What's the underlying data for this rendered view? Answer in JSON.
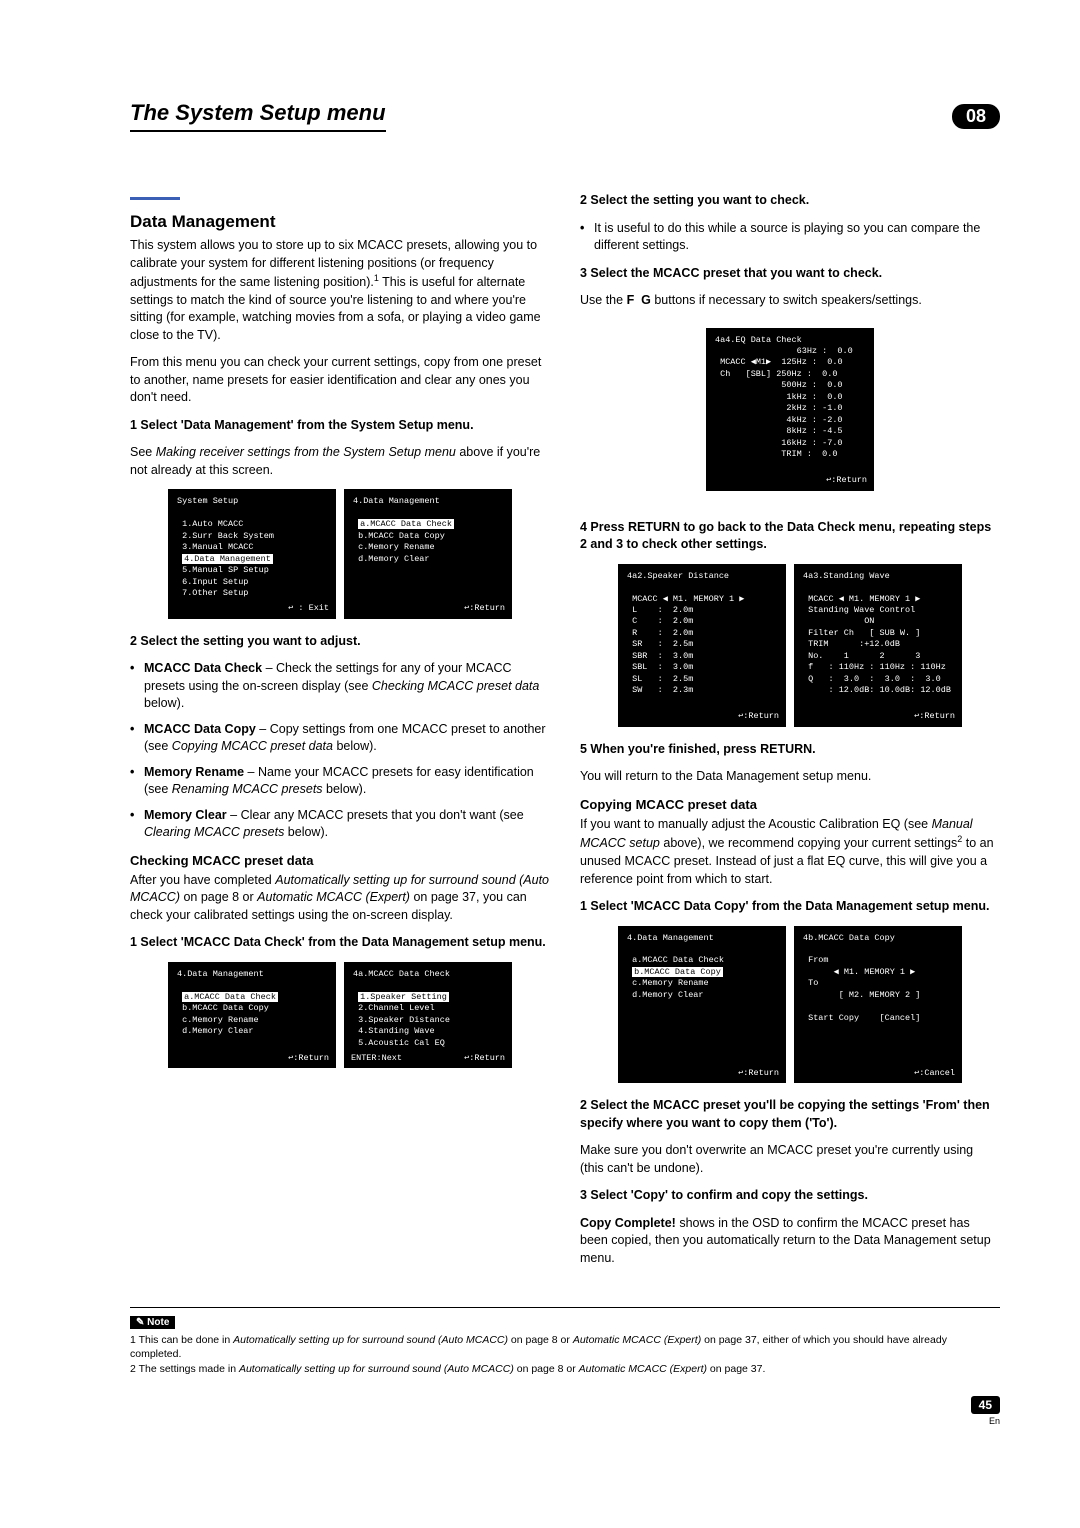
{
  "header": {
    "title": "The System Setup menu",
    "chapter": "08"
  },
  "left": {
    "accent": true,
    "h2": "Data Management",
    "p1a": "This system allows you to store up to six MCACC presets, allowing you to calibrate your system for different listening positions (or frequency adjustments for the same listening position).",
    "p1b": " This is useful for alternate settings to match the kind of source you're listening to and where you're sitting (for example, watching movies from a sofa, or playing a video game close to the TV).",
    "p2": "From this menu you can check your current settings, copy from one preset to another, name presets for easier identification and clear any ones you don't need.",
    "step1": "1   Select 'Data Management' from the System Setup menu.",
    "step1_after_a": "See ",
    "step1_after_i": "Making receiver settings from the System Setup menu",
    "step1_after_b": " above if you're not already at this screen.",
    "osd_sys": "System Setup\n\n  1.Auto MCACC\n  2.Surr Back System\n  3.Manual MCACC\n  4.Data Management\n  5.Manual SP Setup\n  6.Input Setup\n  7.Other Setup",
    "osd_sys_hl": "4.Data Management",
    "osd_sys_foot": "↩ : Exit",
    "osd_dm1": "4.Data Management\n\n  a.MCACC Data Check\n  b.MCACC Data Copy\n  c.Memory Rename\n  d.Memory Clear",
    "osd_dm1_hl": "a.MCACC Data Check",
    "osd_dm1_foot": "↩:Return",
    "step2": "2   Select the setting you want to adjust.",
    "b1a": "MCACC Data Check",
    "b1b": " – Check the settings for any of your MCACC presets using the on-screen display (see ",
    "b1i": "Checking MCACC preset data",
    "b1c": " below).",
    "b2a": "MCACC Data Copy",
    "b2b": " – Copy settings from one MCACC preset to another (see ",
    "b2i": "Copying MCACC preset data",
    "b2c": " below).",
    "b3a": "Memory Rename",
    "b3b": " – Name your MCACC presets for easy identification (see ",
    "b3i": "Renaming MCACC presets",
    "b3c": " below).",
    "b4a": "Memory Clear",
    "b4b": " – Clear any MCACC presets that you don't want (see ",
    "b4i": "Clearing MCACC presets",
    "b4c": " below).",
    "sub1": "Checking MCACC preset data",
    "sub1_p_a": "After you have completed ",
    "sub1_p_i1": "Automatically setting up for surround sound (Auto MCACC)",
    "sub1_p_b": " on page 8 or ",
    "sub1_p_i2": "Automatic MCACC (Expert)",
    "sub1_p_c": " on page 37, you can check your calibrated settings using the on-screen display.",
    "step1b": "1   Select 'MCACC Data Check' from the Data Management setup menu.",
    "osd_dm2": "4.Data Management\n\n  a.MCACC Data Check\n  b.MCACC Data Copy\n  c.Memory Rename\n  d.Memory Clear",
    "osd_dm2_hl": "a.MCACC Data Check",
    "osd_dm2_foot": "↩:Return",
    "osd_dc": "4a.MCACC Data Check\n\n  1.Speaker Setting\n  2.Channel Level\n  3.Speaker Distance\n  4.Standing Wave\n  5.Acoustic Cal EQ",
    "osd_dc_hl": "1.Speaker Setting",
    "osd_dc_footl": "ENTER:Next",
    "osd_dc_foot": "↩:Return"
  },
  "right": {
    "step2": "2   Select the setting you want to check.",
    "step2_note": "It is useful to do this while a source is playing so you can compare the different settings.",
    "step3": "3   Select the MCACC preset that you want to check.",
    "step3_p_a": "Use the  ",
    "step3_p_b": "  buttons if necessary to switch speakers/settings.",
    "osd_eq": "4a4.EQ Data Check\n                63Hz :  0.0\n MCACC ◀M1▶  125Hz :  0.0\n Ch   [SBL] 250Hz :  0.0\n             500Hz :  0.0\n              1kHz :  0.0\n              2kHz : -1.0\n              4kHz : -2.0\n              8kHz : -4.5\n             16kHz : -7.0\n             TRIM :  0.0",
    "osd_eq_foot": "↩:Return",
    "step4": "4   Press RETURN to go back to the Data Check menu, repeating steps 2 and 3 to check other settings.",
    "osd_sp": "4a2.Speaker Distance\n\n MCACC ◀ M1. MEMORY 1 ▶\n L    :  2.0m\n C    :  2.0m\n R    :  2.0m\n SR   :  2.5m\n SBR  :  3.0m\n SBL  :  3.0m\n SL   :  2.5m\n SW   :  2.3m",
    "osd_sp_foot": "↩:Return",
    "osd_sw": "4a3.Standing Wave\n\n MCACC ◀ M1. MEMORY 1 ▶\n Standing Wave Control\n            ON\n Filter Ch   [ SUB W. ]\n TRIM      :+12.0dB\n No.    1      2      3\n f   : 110Hz : 110Hz : 110Hz\n Q   :  3.0  :  3.0  :  3.0\n     : 12.0dB: 10.0dB: 12.0dB",
    "osd_sw_foot": "↩:Return",
    "step5": "5   When you're finished, press RETURN.",
    "step5_p": "You will return to the Data Management setup menu.",
    "sub2": "Copying MCACC preset data",
    "sub2_p_a": "If you want to manually adjust the Acoustic Calibration EQ (see ",
    "sub2_p_i": "Manual MCACC setup",
    "sub2_p_b": " above), we recommend copying your current settings",
    "sub2_p_c": " to an unused MCACC preset. Instead of just a flat EQ curve, this will give you a reference point from which to start.",
    "step1c": "1   Select 'MCACC Data Copy' from the Data Management setup menu.",
    "osd_dm3": "4.Data Management\n\n  a.MCACC Data Check\n  b.MCACC Data Copy\n  c.Memory Rename\n  d.Memory Clear",
    "osd_dm3_hl": "b.MCACC Data Copy",
    "osd_dm3_foot": "↩:Return",
    "osd_cp": "4b.MCACC Data Copy\n\n From\n      ◀ M1. MEMORY 1 ▶\n To\n       [ M2. MEMORY 2 ]\n\n Start Copy    [Cancel]",
    "osd_cp_foot": "↩:Cancel",
    "step2c": "2   Select the MCACC preset you'll be copying the settings 'From' then specify where you want to copy them ('To').",
    "step2c_p": "Make sure you don't overwrite an MCACC preset you're currently using (this can't be undone).",
    "step3c": "3   Select 'Copy' to confirm and copy the settings.",
    "step3c_p_a": "Copy Complete!",
    "step3c_p_b": " shows in the OSD to confirm the MCACC preset has been copied, then you automatically return to the Data Management setup menu."
  },
  "notes": {
    "label": "Note",
    "n1a": "1 This can be done in ",
    "n1i1": "Automatically setting up for surround sound (Auto MCACC)",
    "n1b": " on page 8 or ",
    "n1i2": "Automatic MCACC (Expert)",
    "n1c": " on page 37, either of which you should have already completed.",
    "n2a": "2 The settings made in ",
    "n2i1": "Automatically setting up for surround sound (Auto MCACC)",
    "n2b": " on page 8 or ",
    "n2i2": "Automatic MCACC (Expert)",
    "n2c": " on page 37."
  },
  "page": {
    "num": "45",
    "lang": "En"
  }
}
